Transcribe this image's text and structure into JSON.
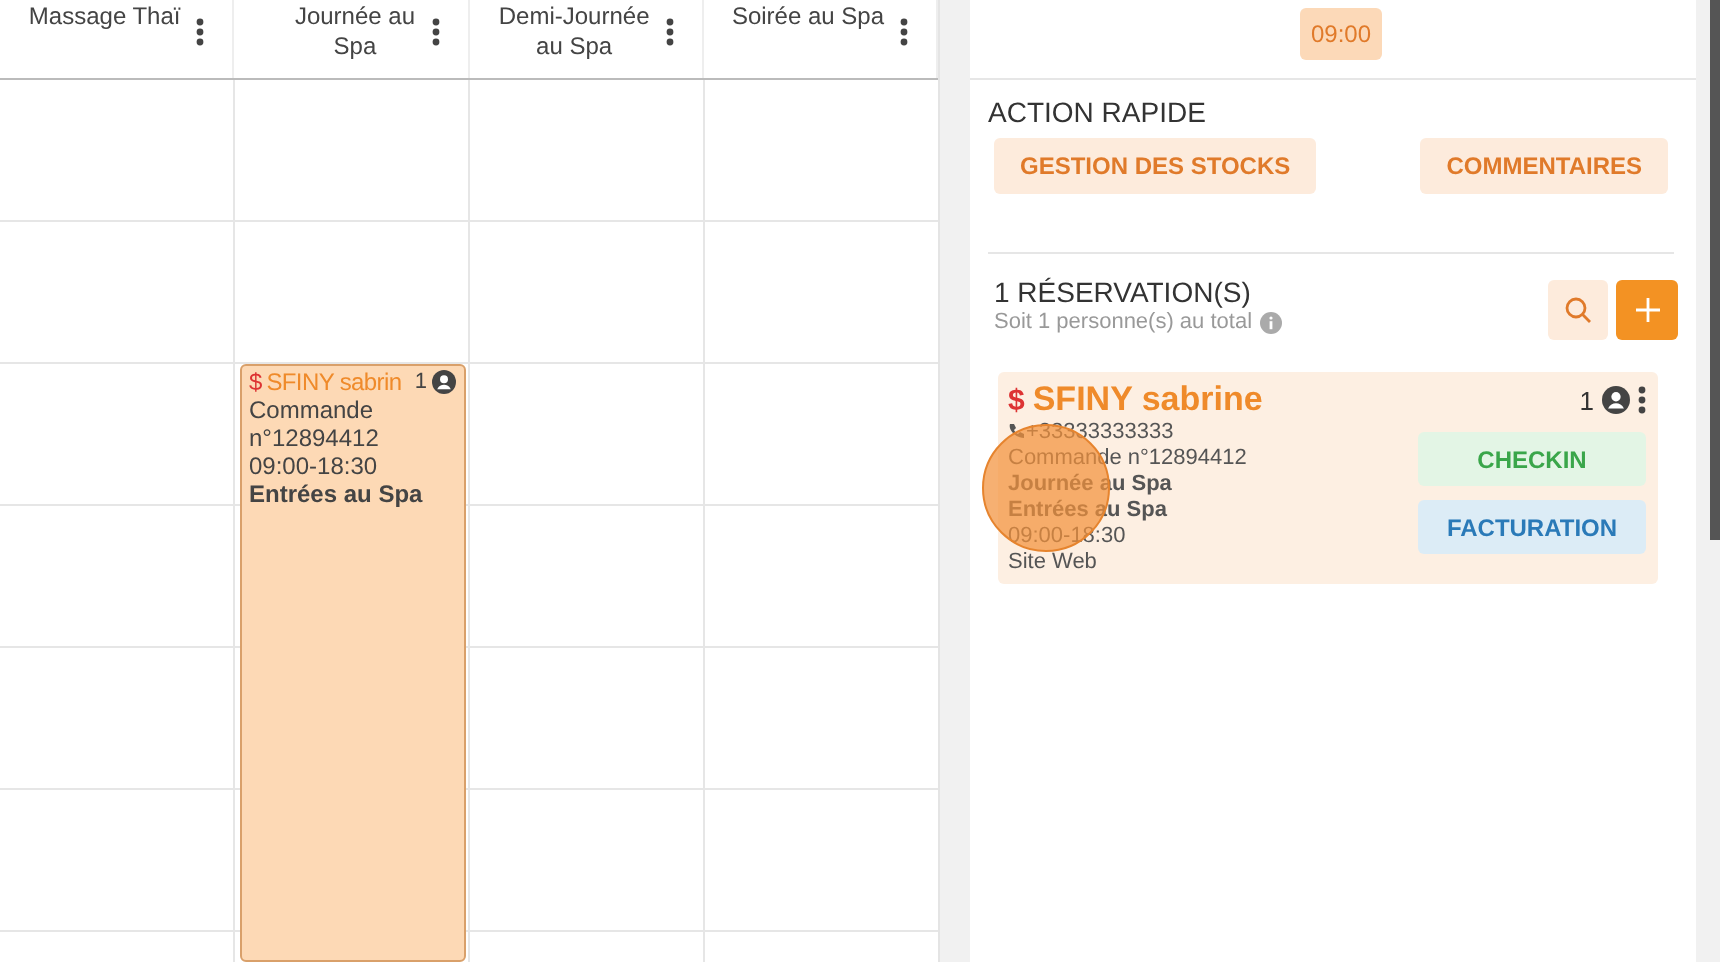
{
  "calendar": {
    "columns": [
      {
        "title_lines": [
          "Massage Thaï"
        ]
      },
      {
        "title_lines": [
          "Journée au",
          "Spa"
        ],
        "booking": {
          "currency": "$",
          "name": "SFINY sabrin",
          "count": "1",
          "lines": [
            {
              "kind": "plain",
              "text": "Commande"
            },
            {
              "kind": "plain",
              "text": "n°12894412"
            },
            {
              "kind": "plain",
              "text": "09:00-18:30"
            },
            {
              "kind": "bold",
              "text": "Entrées au Spa"
            }
          ]
        }
      },
      {
        "title_lines": [
          "Demi-Journée",
          "au Spa"
        ]
      },
      {
        "title_lines": [
          "Soirée au Spa"
        ]
      }
    ]
  },
  "panel": {
    "time": "09:00",
    "quick_actions": {
      "title": "ACTION RAPIDE",
      "buttons": [
        "GESTION DES STOCKS",
        "COMMENTAIRES"
      ]
    },
    "reservations": {
      "title": "1 RÉSERVATION(S)",
      "subtitle": "Soit 1 personne(s) au total"
    },
    "card": {
      "currency": "$",
      "name": "SFINY sabrine",
      "count": "1",
      "lines": [
        {
          "kind": "phone",
          "text": "+33333333333"
        },
        {
          "kind": "plain",
          "text": "Commande n°12894412"
        },
        {
          "kind": "bold",
          "text": "Journée au Spa"
        },
        {
          "kind": "bold",
          "text": "Entrées au Spa"
        },
        {
          "kind": "plain",
          "text": "09:00-18:30"
        },
        {
          "kind": "plain",
          "text": "Site Web"
        }
      ],
      "actions": [
        {
          "kind": "checkin",
          "label": "CHECKIN"
        },
        {
          "kind": "billing",
          "label": "FACTURATION"
        }
      ]
    }
  }
}
